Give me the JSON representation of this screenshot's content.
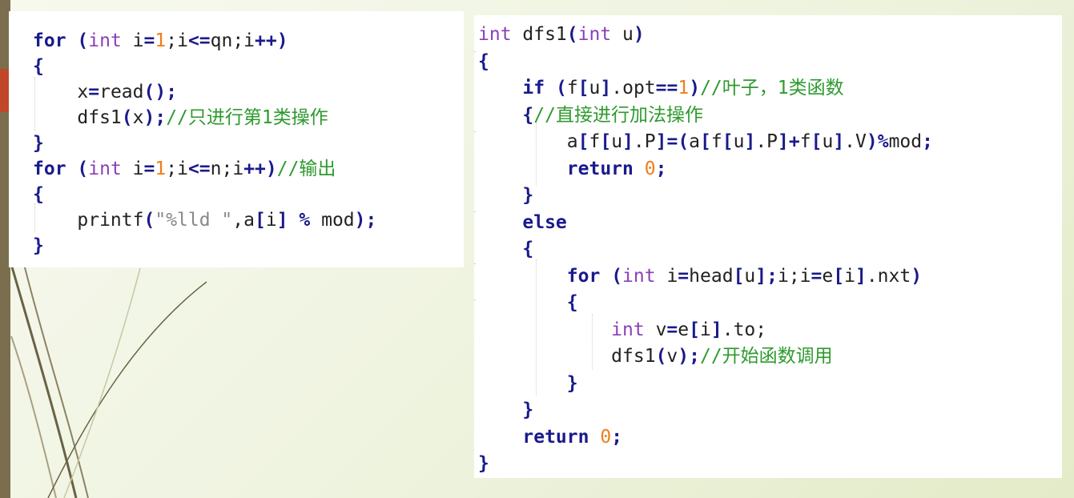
{
  "left_snippet": {
    "lines": [
      [
        {
          "t": "for",
          "c": "kw"
        },
        {
          "t": " ",
          "c": ""
        },
        {
          "t": "(",
          "c": "op"
        },
        {
          "t": "int",
          "c": "ty"
        },
        {
          "t": " i",
          "c": ""
        },
        {
          "t": "=",
          "c": "op"
        },
        {
          "t": "1",
          "c": "num"
        },
        {
          "t": ";i",
          "c": ""
        },
        {
          "t": "<=",
          "c": "op"
        },
        {
          "t": "qn;i",
          "c": ""
        },
        {
          "t": "++)",
          "c": "op"
        }
      ],
      [
        {
          "t": "{",
          "c": "op"
        }
      ],
      [
        {
          "t": "    x",
          "c": ""
        },
        {
          "t": "=",
          "c": "op"
        },
        {
          "t": "read",
          "c": ""
        },
        {
          "t": "();",
          "c": "op"
        }
      ],
      [
        {
          "t": "    dfs1",
          "c": ""
        },
        {
          "t": "(",
          "c": "op"
        },
        {
          "t": "x",
          "c": ""
        },
        {
          "t": ");",
          "c": "op"
        },
        {
          "t": "//只进行第1类操作",
          "c": "cm"
        }
      ],
      [
        {
          "t": "}",
          "c": "op"
        }
      ],
      [
        {
          "t": "for",
          "c": "kw"
        },
        {
          "t": " ",
          "c": ""
        },
        {
          "t": "(",
          "c": "op"
        },
        {
          "t": "int",
          "c": "ty"
        },
        {
          "t": " i",
          "c": ""
        },
        {
          "t": "=",
          "c": "op"
        },
        {
          "t": "1",
          "c": "num"
        },
        {
          "t": ";i",
          "c": ""
        },
        {
          "t": "<=",
          "c": "op"
        },
        {
          "t": "n;i",
          "c": ""
        },
        {
          "t": "++)",
          "c": "op"
        },
        {
          "t": "//输出",
          "c": "cm"
        }
      ],
      [
        {
          "t": "{",
          "c": "op"
        }
      ],
      [
        {
          "t": "    printf",
          "c": ""
        },
        {
          "t": "(",
          "c": "op"
        },
        {
          "t": "\"%lld \"",
          "c": "str"
        },
        {
          "t": ",a",
          "c": ""
        },
        {
          "t": "[",
          "c": "op"
        },
        {
          "t": "i",
          "c": ""
        },
        {
          "t": "]",
          "c": "op"
        },
        {
          "t": " % ",
          "c": "op"
        },
        {
          "t": "mod",
          "c": ""
        },
        {
          "t": ");",
          "c": "op"
        }
      ],
      [
        {
          "t": "}",
          "c": "op"
        }
      ]
    ]
  },
  "right_snippet": {
    "lines": [
      [
        {
          "t": "int",
          "c": "ty"
        },
        {
          "t": " dfs1",
          "c": ""
        },
        {
          "t": "(",
          "c": "op"
        },
        {
          "t": "int",
          "c": "ty"
        },
        {
          "t": " u",
          "c": ""
        },
        {
          "t": ")",
          "c": "op"
        }
      ],
      [
        {
          "t": "{",
          "c": "op"
        }
      ],
      [
        {
          "t": "    ",
          "c": ""
        },
        {
          "t": "if",
          "c": "kw"
        },
        {
          "t": " ",
          "c": ""
        },
        {
          "t": "(",
          "c": "op"
        },
        {
          "t": "f",
          "c": ""
        },
        {
          "t": "[",
          "c": "op"
        },
        {
          "t": "u",
          "c": ""
        },
        {
          "t": "]",
          "c": "op"
        },
        {
          "t": ".opt",
          "c": ""
        },
        {
          "t": "==",
          "c": "op"
        },
        {
          "t": "1",
          "c": "num"
        },
        {
          "t": ")",
          "c": "op"
        },
        {
          "t": "//叶子，1类函数",
          "c": "cm"
        }
      ],
      [
        {
          "t": "    ",
          "c": ""
        },
        {
          "t": "{",
          "c": "op"
        },
        {
          "t": "//直接进行加法操作",
          "c": "cm"
        }
      ],
      [
        {
          "t": "        a",
          "c": ""
        },
        {
          "t": "[",
          "c": "op"
        },
        {
          "t": "f",
          "c": ""
        },
        {
          "t": "[",
          "c": "op"
        },
        {
          "t": "u",
          "c": ""
        },
        {
          "t": "]",
          "c": "op"
        },
        {
          "t": ".P",
          "c": ""
        },
        {
          "t": "]=(",
          "c": "op"
        },
        {
          "t": "a",
          "c": ""
        },
        {
          "t": "[",
          "c": "op"
        },
        {
          "t": "f",
          "c": ""
        },
        {
          "t": "[",
          "c": "op"
        },
        {
          "t": "u",
          "c": ""
        },
        {
          "t": "]",
          "c": "op"
        },
        {
          "t": ".P",
          "c": ""
        },
        {
          "t": "]+",
          "c": "op"
        },
        {
          "t": "f",
          "c": ""
        },
        {
          "t": "[",
          "c": "op"
        },
        {
          "t": "u",
          "c": ""
        },
        {
          "t": "]",
          "c": "op"
        },
        {
          "t": ".V",
          "c": ""
        },
        {
          "t": ")%",
          "c": "op"
        },
        {
          "t": "mod",
          "c": ""
        },
        {
          "t": ";",
          "c": "op"
        }
      ],
      [
        {
          "t": "        ",
          "c": ""
        },
        {
          "t": "return",
          "c": "kw"
        },
        {
          "t": " ",
          "c": ""
        },
        {
          "t": "0",
          "c": "num"
        },
        {
          "t": ";",
          "c": "op"
        }
      ],
      [
        {
          "t": "    ",
          "c": ""
        },
        {
          "t": "}",
          "c": "op"
        }
      ],
      [
        {
          "t": "    ",
          "c": ""
        },
        {
          "t": "else",
          "c": "kw"
        }
      ],
      [
        {
          "t": "    ",
          "c": ""
        },
        {
          "t": "{",
          "c": "op"
        }
      ],
      [
        {
          "t": "        ",
          "c": ""
        },
        {
          "t": "for",
          "c": "kw"
        },
        {
          "t": " ",
          "c": ""
        },
        {
          "t": "(",
          "c": "op"
        },
        {
          "t": "int",
          "c": "ty"
        },
        {
          "t": " i",
          "c": ""
        },
        {
          "t": "=",
          "c": "op"
        },
        {
          "t": "head",
          "c": ""
        },
        {
          "t": "[",
          "c": "op"
        },
        {
          "t": "u",
          "c": ""
        },
        {
          "t": "];",
          "c": "op"
        },
        {
          "t": "i;i",
          "c": ""
        },
        {
          "t": "=",
          "c": "op"
        },
        {
          "t": "e",
          "c": ""
        },
        {
          "t": "[",
          "c": "op"
        },
        {
          "t": "i",
          "c": ""
        },
        {
          "t": "]",
          "c": "op"
        },
        {
          "t": ".nxt",
          "c": ""
        },
        {
          "t": ")",
          "c": "op"
        }
      ],
      [
        {
          "t": "        ",
          "c": ""
        },
        {
          "t": "{",
          "c": "op"
        }
      ],
      [
        {
          "t": "            ",
          "c": ""
        },
        {
          "t": "int",
          "c": "ty"
        },
        {
          "t": " v",
          "c": ""
        },
        {
          "t": "=",
          "c": "op"
        },
        {
          "t": "e",
          "c": ""
        },
        {
          "t": "[",
          "c": "op"
        },
        {
          "t": "i",
          "c": ""
        },
        {
          "t": "]",
          "c": "op"
        },
        {
          "t": ".to;",
          "c": ""
        }
      ],
      [
        {
          "t": "            dfs1",
          "c": ""
        },
        {
          "t": "(",
          "c": "op"
        },
        {
          "t": "v",
          "c": ""
        },
        {
          "t": ");",
          "c": "op"
        },
        {
          "t": "//开始函数调用",
          "c": "cm"
        }
      ],
      [
        {
          "t": "        ",
          "c": ""
        },
        {
          "t": "}",
          "c": "op"
        }
      ],
      [
        {
          "t": "    ",
          "c": ""
        },
        {
          "t": "}",
          "c": "op"
        }
      ],
      [
        {
          "t": "    ",
          "c": ""
        },
        {
          "t": "return",
          "c": "kw"
        },
        {
          "t": " ",
          "c": ""
        },
        {
          "t": "0",
          "c": "num"
        },
        {
          "t": ";",
          "c": "op"
        }
      ],
      [
        {
          "t": "}",
          "c": "op"
        }
      ]
    ]
  },
  "colors": {
    "keyword": "#1a1a8c",
    "type": "#8a3fb8",
    "number": "#f07d1a",
    "comment": "#2e9a2e",
    "string": "#888888",
    "accent_bar": "#7a6e4e",
    "accent_tab": "#c0472a"
  }
}
